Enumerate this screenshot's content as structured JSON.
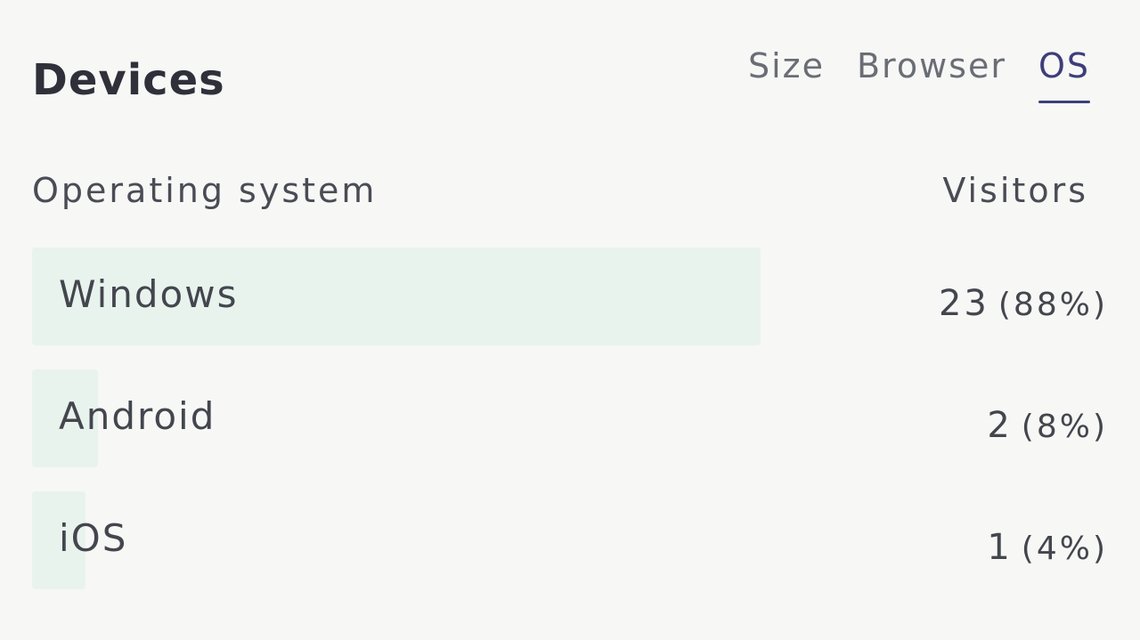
{
  "panel": {
    "title": "Devices",
    "tabs": [
      {
        "label": "Size",
        "active": false
      },
      {
        "label": "Browser",
        "active": false
      },
      {
        "label": "OS",
        "active": true
      }
    ]
  },
  "table": {
    "column_left": "Operating system",
    "column_right": "Visitors",
    "rows": [
      {
        "label": "Windows",
        "count": "23",
        "percent": "(88%)",
        "share": 0.88
      },
      {
        "label": "Android",
        "count": "2",
        "percent": "(8%)",
        "share": 0.08
      },
      {
        "label": "iOS",
        "count": "1",
        "percent": "(4%)",
        "share": 0.04
      }
    ]
  },
  "colors": {
    "accent": "#3d3e7a",
    "bar": "#e9f3ee"
  }
}
